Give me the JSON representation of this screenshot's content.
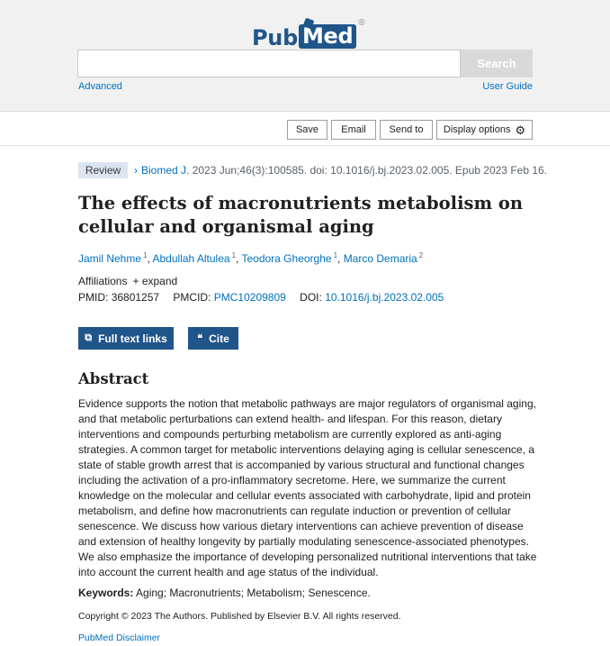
{
  "header": {
    "logo_pub": "Pub",
    "logo_med": "Med",
    "logo_reg": "®",
    "search_placeholder": "",
    "search_label": "Search",
    "advanced_label": "Advanced",
    "user_guide_label": "User Guide"
  },
  "actions": {
    "save": "Save",
    "email": "Email",
    "send_to": "Send to",
    "display_options": "Display options"
  },
  "article": {
    "badge": "Review",
    "journal": "Biomed J.",
    "citation": " 2023 Jun;46(3):100585. doi: 10.1016/j.bj.2023.02.005. Epub 2023 Feb 16.",
    "title": "The effects of macronutrients metabolism on cellular and organismal aging",
    "authors": [
      {
        "name": "Jamil Nehme",
        "sup": "1"
      },
      {
        "name": "Abdullah Altulea",
        "sup": "1"
      },
      {
        "name": "Teodora Gheorghe",
        "sup": "1"
      },
      {
        "name": "Marco Demaria",
        "sup": "2"
      }
    ],
    "affiliations_label": "Affiliations",
    "expand_label": "+ expand",
    "pmid_label": "PMID:",
    "pmid": "36801257",
    "pmcid_label": "PMCID:",
    "pmcid": "PMC10209809",
    "doi_label": "DOI:",
    "doi": "10.1016/j.bj.2023.02.005",
    "full_text_label": "Full text links",
    "cite_label": "Cite",
    "abstract_heading": "Abstract",
    "abstract": "Evidence supports the notion that metabolic pathways are major regulators of organismal aging, and that metabolic perturbations can extend health- and lifespan. For this reason, dietary interventions and compounds perturbing metabolism are currently explored as anti-aging strategies. A common target for metabolic interventions delaying aging is cellular senescence, a state of stable growth arrest that is accompanied by various structural and functional changes including the activation of a pro-inflammatory secretome. Here, we summarize the current knowledge on the molecular and cellular events associated with carbohydrate, lipid and protein metabolism, and define how macronutrients can regulate induction or prevention of cellular senescence. We discuss how various dietary interventions can achieve prevention of disease and extension of healthy longevity by partially modulating senescence-associated phenotypes. We also emphasize the importance of developing personalized nutritional interventions that take into account the current health and age status of the individual.",
    "keywords_label": "Keywords:",
    "keywords": " Aging; Macronutrients; Metabolism; Senescence.",
    "copyright": "Copyright © 2023 The Authors. Published by Elsevier B.V. All rights reserved.",
    "disclaimer": "PubMed Disclaimer"
  },
  "colors": {
    "brand": "#20558a",
    "link": "#0071bc",
    "badge_bg": "#dce4ef",
    "header_bg": "#f1f1f1"
  }
}
